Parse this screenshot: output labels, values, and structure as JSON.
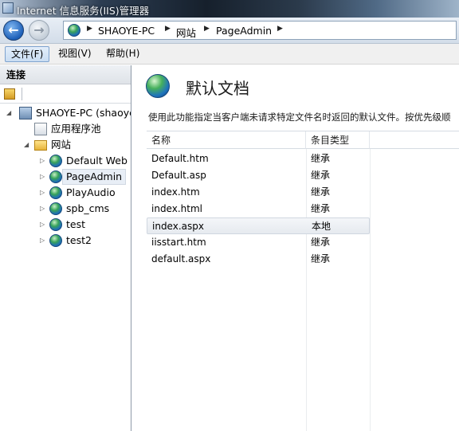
{
  "window": {
    "title": "Internet 信息服务(IIS)管理器"
  },
  "nav": {
    "back_glyph": "←",
    "forward_glyph": "→",
    "breadcrumb": [
      "SHAOYE-PC",
      "网站",
      "PageAdmin"
    ]
  },
  "menu": [
    "文件(F)",
    "视图(V)",
    "帮助(H)"
  ],
  "connections": {
    "header": "连接",
    "tree": {
      "server": "SHAOYE-PC (shaoye",
      "app_pools": "应用程序池",
      "sites_folder": "网站",
      "sites": [
        "Default Web S",
        "PageAdmin",
        "PlayAudio",
        "spb_cms",
        "test",
        "test2"
      ],
      "selected_site": "PageAdmin"
    }
  },
  "feature": {
    "title": "默认文档",
    "description": "使用此功能指定当客户端未请求特定文件名时返回的默认文件。按优先级顺",
    "columns": [
      "名称",
      "条目类型"
    ],
    "rows": [
      {
        "name": "Default.htm",
        "type": "继承"
      },
      {
        "name": "Default.asp",
        "type": "继承"
      },
      {
        "name": "index.htm",
        "type": "继承"
      },
      {
        "name": "index.html",
        "type": "继承"
      },
      {
        "name": "index.aspx",
        "type": "本地"
      },
      {
        "name": "iisstart.htm",
        "type": "继承"
      },
      {
        "name": "default.aspx",
        "type": "继承"
      }
    ],
    "selected_row": "index.aspx"
  },
  "icons": {
    "app_icon": "iis-manager-icon",
    "site_icon": "globe-icon",
    "server_icon": "server-icon",
    "pool_icon": "app-pool-icon",
    "folder_icon": "folder-icon"
  }
}
